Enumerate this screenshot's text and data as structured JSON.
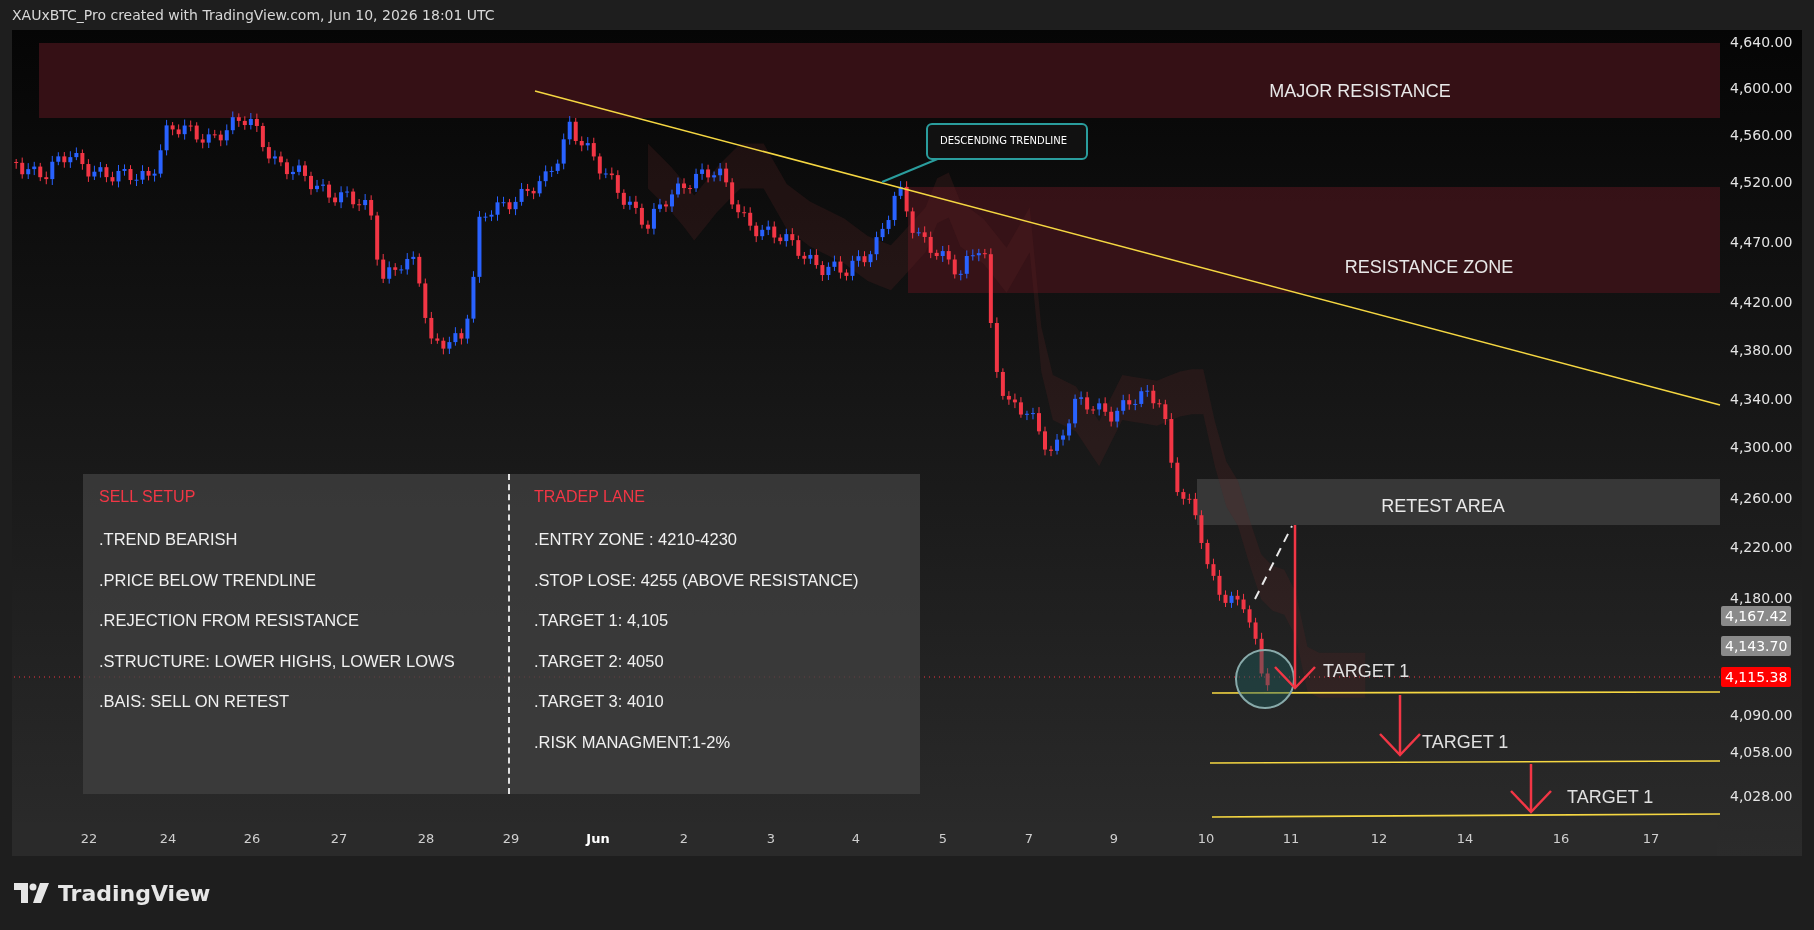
{
  "header": {
    "text": "XAUxBTC_Pro created with TradingView.com, Jun 10, 2026 18:01 UTC"
  },
  "chart": {
    "zones": [
      {
        "kind": "major",
        "label": "MAJOR RESISTANCE"
      },
      {
        "kind": "resistance",
        "label": "RESISTANCE ZONE"
      },
      {
        "kind": "retest",
        "label": "RETEST AREA"
      }
    ],
    "callout": {
      "text": "DESCENDING TRENDLINE"
    },
    "targets": [
      {
        "label": "TARGET 1"
      },
      {
        "label": "TARGET 1"
      },
      {
        "label": "TARGET 1"
      }
    ],
    "setup_panel": {
      "left": {
        "title": "SELL SETUP",
        "items": [
          ".TREND BEARISH",
          ".PRICE BELOW TRENDLINE",
          ".REJECTION FROM RESISTANCE",
          ".STRUCTURE: LOWER HIGHS, LOWER LOWS",
          ".BAIS: SELL ON RETEST"
        ]
      },
      "right": {
        "title": "TRADEP LANE",
        "items": [
          ".ENTRY ZONE : 4210-4230",
          ".STOP LOSE: 4255 (ABOVE RESISTANCE)",
          ".TARGET 1: 4,105",
          ".TARGET 2: 4050",
          ".TARGET 3: 4010",
          ".RISK MANAGMENT:1-2%"
        ]
      }
    },
    "price_axis": {
      "labels": [
        "4,640.00",
        "4,600.00",
        "4,560.00",
        "4,520.00",
        "4,470.00",
        "4,420.00",
        "4,380.00",
        "4,340.00",
        "4,300.00",
        "4,260.00",
        "4,220.00",
        "4,180.00",
        "4,090.00",
        "4,058.00",
        "4,028.00"
      ]
    },
    "price_tags": [
      {
        "text": "4,167.42",
        "kind": "marker"
      },
      {
        "text": "4,143.70",
        "kind": "marker"
      },
      {
        "text": "4,115.38",
        "kind": "current"
      }
    ],
    "date_axis": {
      "labels": [
        {
          "text": "22",
          "kind": "day"
        },
        {
          "text": "24",
          "kind": "day"
        },
        {
          "text": "26",
          "kind": "day"
        },
        {
          "text": "27",
          "kind": "day"
        },
        {
          "text": "28",
          "kind": "day"
        },
        {
          "text": "29",
          "kind": "day"
        },
        {
          "text": "Jun",
          "kind": "month"
        },
        {
          "text": "2",
          "kind": "day"
        },
        {
          "text": "3",
          "kind": "day"
        },
        {
          "text": "4",
          "kind": "day"
        },
        {
          "text": "5",
          "kind": "day"
        },
        {
          "text": "7",
          "kind": "day"
        },
        {
          "text": "9",
          "kind": "day"
        },
        {
          "text": "10",
          "kind": "day"
        },
        {
          "text": "11",
          "kind": "day"
        },
        {
          "text": "12",
          "kind": "day"
        },
        {
          "text": "14",
          "kind": "day"
        },
        {
          "text": "16",
          "kind": "day"
        },
        {
          "text": "17",
          "kind": "day"
        }
      ]
    }
  },
  "footer": {
    "logo_text": "TradingView"
  }
}
